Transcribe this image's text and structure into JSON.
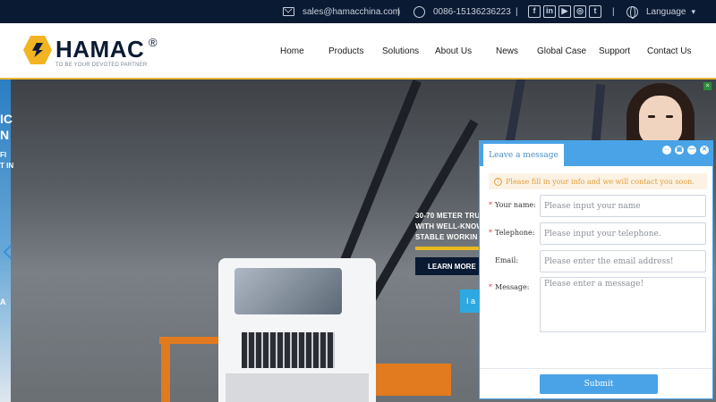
{
  "topbar": {
    "email": "sales@hamacchina.com",
    "separator": "|",
    "phone": "0086-15136236223",
    "social": [
      "f",
      "in",
      "▶",
      "◎",
      "t"
    ],
    "language": "Language",
    "caret": "▾"
  },
  "header": {
    "logo_text": "HAMAC",
    "logo_reg": "®",
    "tagline": "TO BE YOUR DEVOTED PARTNER",
    "nav": [
      "Home",
      "Products",
      "Solutions",
      "About Us",
      "News",
      "Global Case",
      "Support",
      "Contact Us"
    ]
  },
  "hero": {
    "left_fragments": [
      "IC",
      "N",
      "FI",
      "T IN",
      "A"
    ],
    "headline_lines": [
      "30-70 METER TRU",
      "WITH WELL-KNOW",
      "STABLE WORKIN"
    ],
    "learn_more": "LEARN MORE",
    "chat_tab_fragment": "I a",
    "close_x": "×"
  },
  "panel": {
    "tab_label": "Leave a message",
    "window_buttons": [
      "⇔",
      "▣",
      "—",
      "✕"
    ],
    "notice": "Please fill in your info and we will contact you soon.",
    "info_glyph": "!",
    "required_mark": "*",
    "fields": [
      {
        "label": "Your name:",
        "placeholder": "Please input your name",
        "required": true
      },
      {
        "label": "Telephone:",
        "placeholder": "Please input your telephone.",
        "required": true
      },
      {
        "label": "Email:",
        "placeholder": "Please enter the email address!",
        "required": false
      },
      {
        "label": "Message:",
        "placeholder": "Please enter a message!",
        "required": true
      }
    ],
    "submit": "Submit"
  },
  "colors": {
    "topbar_bg": "#0b1a33",
    "brand_yellow": "#f2b422",
    "panel_blue": "#4aa3e6",
    "notice_text": "#e59c3a"
  }
}
